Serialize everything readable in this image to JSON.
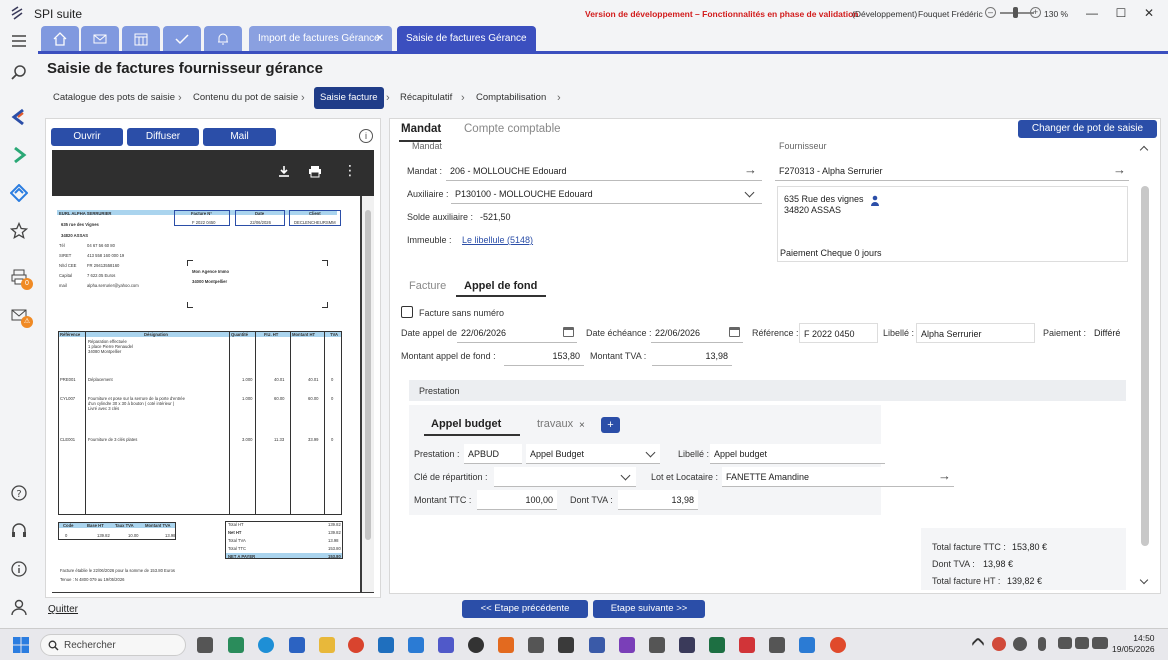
{
  "app": {
    "name": "SPI suite",
    "dev_warning": "Version de développement – Fonctionnalités en phase de validation",
    "environment": "(Développement)",
    "user": "Fouquet Frédéric",
    "zoom": "130 %",
    "zoom_minus": "–",
    "zoom_plus": "+"
  },
  "window_controls": {
    "minimize": "—",
    "maximize": "☐",
    "close": "✕"
  },
  "rail": {
    "badges": {
      "printer": "0",
      "mail": "⚠"
    }
  },
  "tabs": [
    {
      "label": "Import de factures Gérance",
      "close": "✕"
    },
    {
      "label": "Saisie de factures Gérance",
      "close": "✕"
    }
  ],
  "page": {
    "title": "Saisie de factures fournisseur gérance"
  },
  "breadcrumb": [
    "Catalogue des pots de saisie",
    "Contenu du pot de saisie",
    "Saisie facture",
    "Récapitulatif",
    "Comptabilisation"
  ],
  "breadcrumb_sep": "›",
  "viewer": {
    "open_label": "Ouvrir",
    "share_label": "Diffuser",
    "mail_label": "Mail",
    "info": "i",
    "menu": "⋮",
    "invoice": {
      "company": "EURL ALPHA SERRURIER",
      "street": "635 rue des Vignes",
      "city": "34820  ASSAS",
      "col_invoice": "Facture N°",
      "col_date": "Date",
      "col_client": "Client",
      "invoice_no": "F 2022 0450",
      "invoice_date": "22/06/2026",
      "client": "DECLENCHEURSMM",
      "tel_label": "Tél",
      "tel": "04 67 56 60 80",
      "siret_label": "SIRET",
      "siret": "413 558 160 000 19",
      "tva_label": "N/Id CEE",
      "tva": "FR 29413558160",
      "capital_label": "Capital",
      "capital": "7 622.05 Euros",
      "mail_label": "mail",
      "mail": "alpha.serrurier@yahoo.com",
      "recipient_1": "Mon Agence Immo",
      "recipient_2": "34000 Montpellier",
      "headers": [
        "Référence",
        "Désignation",
        "Quantité",
        "P.U. HT",
        "Montant HT",
        "TVA"
      ],
      "lines": [
        {
          "ref": "",
          "desc": [
            "Réparation effectuée",
            "1 place Pierre Renaudel",
            "34080 Montpellier"
          ],
          "qty": "",
          "pu": "",
          "amount": "",
          "tva": ""
        },
        {
          "ref": "PRE001",
          "desc": [
            "Déplacement"
          ],
          "qty": "1.000",
          "pu": "40.01",
          "amount": "40.01",
          "tva": "0"
        },
        {
          "ref": "CYL007",
          "desc": [
            "Fourniture et pose sur la serrure de la porte d'entrée",
            "d'un cylindre 30 x 30 à bouton ( coté intérieur )",
            "Livré avec 3 clés"
          ],
          "qty": "1.000",
          "pu": "60.00",
          "amount": "60.00",
          "tva": "0"
        },
        {
          "ref": "CLE001",
          "desc": [
            "Fourniture  de 3 clés plates"
          ],
          "qty": "3.000",
          "pu": "11.33",
          "amount": "33.99",
          "tva": "0"
        }
      ],
      "summary_headers": [
        "Code",
        "Base HT",
        "Taux TVA",
        "Montant TVA"
      ],
      "summary_row": [
        "0",
        "139.82",
        "10.00",
        "13.98"
      ],
      "totals": [
        {
          "label": "Total HT",
          "value": "139.82"
        },
        {
          "label": "Net HT",
          "value": "139.82"
        },
        {
          "label": "Total TVA",
          "value": "13.98"
        },
        {
          "label": "Total TTC",
          "value": "153.80"
        },
        {
          "label": "NET A PAYER",
          "value": "153.80"
        }
      ],
      "footer_1": "Facture établie le 22/06/2026 pour la somme de 153.80 Euros",
      "footer_2": "Tenue : N 4800 079 au 19/05/2026"
    }
  },
  "sections": {
    "mandat_tab": "Mandat",
    "compte_tab": "Compte comptable",
    "change_pot_button": "Changer de pot de saisie"
  },
  "mandat": {
    "header_left": "Mandat",
    "header_right": "Fournisseur",
    "mandat_label": "Mandat :",
    "mandat_value": "206 - MOLLOUCHE Edouard",
    "auxiliaire_label": "Auxiliaire :",
    "auxiliaire_value": "P130100 - MOLLOUCHE Edouard",
    "solde_label": "Solde auxiliaire :",
    "solde_value": "-521,50",
    "immeuble_label": "Immeuble :",
    "immeuble_value": "Le libellule (5148)"
  },
  "fournisseur": {
    "value": "F270313 - Alpha Serrurier",
    "address_1": "635 Rue des vignes",
    "address_2": "34820 ASSAS",
    "payment": "Paiement Cheque 0 jours"
  },
  "invoice_tabs": {
    "facture": "Facture",
    "appel": "Appel de fond"
  },
  "appel": {
    "sans_numero": "Facture sans numéro",
    "date_appel_label": "Date appel de fond :",
    "date_appel": "22/06/2026",
    "date_echeance_label": "Date échéance :",
    "date_echeance": "22/06/2026",
    "reference_label": "Référence :",
    "reference": "F 2022 0450",
    "libelle_label": "Libellé :",
    "libelle": "Alpha Serrurier",
    "paiement_label": "Paiement :",
    "paiement": "Différé",
    "montant_label": "Montant appel de fond :",
    "montant": "153,80",
    "montant_tva_label": "Montant TVA :",
    "montant_tva": "13,98"
  },
  "prestation": {
    "header": "Prestation",
    "tab_budget": "Appel budget",
    "tab_travaux": "travaux",
    "tab_close": "×",
    "add_button": "+",
    "prestation_label": "Prestation :",
    "prestation_code": "APBUD",
    "prestation_value": "Appel Budget",
    "libelle_label": "Libellé :",
    "libelle_value": "Appel budget",
    "cle_label": "Clé de répartition :",
    "cle_value": "",
    "lot_label": "Lot et Locataire :",
    "lot_value": "FANETTE Amandine",
    "ttc_label": "Montant TTC :",
    "ttc_value": "100,00",
    "tva_label": "Dont TVA :",
    "tva_value": "13,98"
  },
  "totals": {
    "ttc_label": "Total facture TTC :",
    "ttc_value": "153,80 €",
    "tva_label": "Dont TVA :",
    "tva_value": "13,98 €",
    "ht_label": "Total facture HT :",
    "ht_value": "139,82 €"
  },
  "footer": {
    "quit": "Quitter",
    "prev": "<< Etape précédente",
    "next": "Etape suivante >>"
  },
  "taskbar": {
    "search": "Rechercher",
    "time": "14:50",
    "date": "19/05/2026"
  }
}
